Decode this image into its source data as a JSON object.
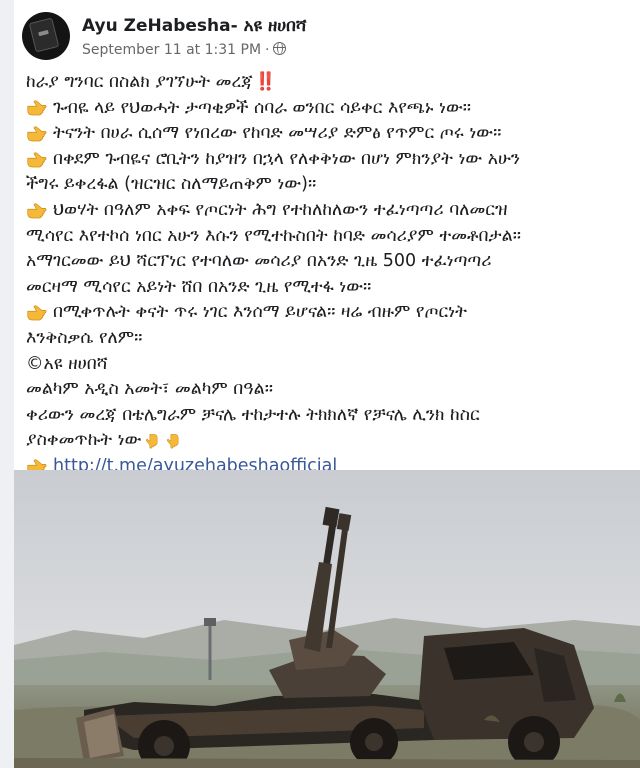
{
  "post": {
    "author": "Ayu ZeHabesha- አዩ ዘሀበሻ",
    "date": "September 11 at 1:31 PM",
    "separator": "·",
    "privacy_icon": "globe-icon",
    "lines": [
      {
        "text": "ከራያ ግንባር በስልክ ያገኘሁት መረጃ",
        "suffix": "‼️"
      },
      {
        "text": "ጉብዬ ላይ የህወሓት ታጣቂዎች ሰባራ ወንበር ሳይቀር እየጫኑ ነው፡፡",
        "icon": "pointing-hand-icon"
      },
      {
        "text": "ትናንት በሀራ ሲሰማ የነበረው የከባድ መሣሪያ ድምፅ የጥምር ጦሩ ነው፡፡",
        "icon": "pointing-hand-icon"
      },
      {
        "text": "በቀደም ጉብዬና ሮቢትን ከያዝን በኋላ የለቀቅነው በሆነ ምክንያት ነው አሁን",
        "icon": "pointing-hand-icon"
      },
      {
        "text": "ችግሩ ይቀረፋል (ዝርዝር ስለማይጠቅም ነው)፡፡"
      },
      {
        "text": "ህወሃት በዓለም አቀፍ የጦርነት ሕግ የተከለከለውን ተፈነጣጣሪ ባለመርዝ",
        "icon": "pointing-hand-icon"
      },
      {
        "text": "ሚሳየር እየተኮሰ ነበር አሁን እሱን የሚተኩስበት ከባድ መሳሪያም ተመቶበታል፡፡"
      },
      {
        "text": "አማገርመው ይህ ሻርፕነር የተባለው መሳሪያ በአንድ ጊዜ 500 ተፈነጣጣሪ"
      },
      {
        "text": "መርዛማ ሚሳየር አይነት ሸበ በአንድ ጊዜ የሚተፋ ነው፡፡"
      },
      {
        "text": "በሚቀጥሉት ቀናት ጥሩ ነገር እንሰማ ይሆናል፡፡ ዛሬ ብዙም የጦርነት",
        "icon": "pointing-hand-icon"
      },
      {
        "text": "እንቅስቃሴ የለም፡፡"
      },
      {
        "text": "©አዩ ዘሀበሻ"
      },
      {
        "text": "መልካም አዲስ አመት፣ መልካም በዓል፡፡"
      },
      {
        "text": "ቀሪውን መረጃ በቴሌግራም ቻናሌ ተከታተሉ ትክክለኛ የቻናሌ ሊንክ ከስር"
      },
      {
        "text": "ያስቀመጥኩት ነው",
        "trail_icons": [
          "pointing-down-icon",
          "pointing-down-icon"
        ]
      },
      {
        "text": "http://t.me/ayuzehabeshaofficial",
        "icon": "pointing-hand-icon",
        "is_link": true
      }
    ]
  },
  "colors": {
    "text": "#1c1e21",
    "meta": "#65676b",
    "link": "#385898",
    "emoji": "#f5b93a",
    "alert": "#e0245e"
  },
  "photo": {
    "subject": "burned-out military truck with anti-aircraft gun in field",
    "icon": "photo-icon"
  }
}
